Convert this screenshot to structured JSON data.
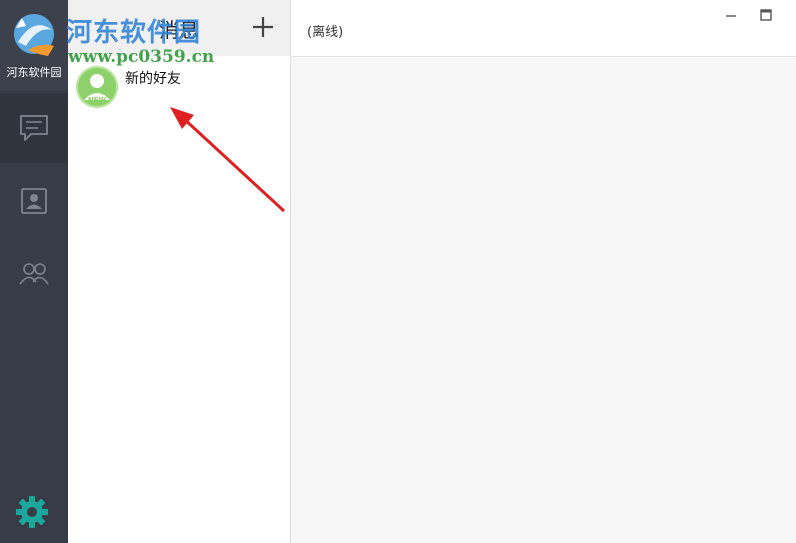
{
  "sidebar": {
    "logo_label": "河东软件园",
    "nav": [
      {
        "icon": "chat-bubble-icon",
        "active": true
      },
      {
        "icon": "contact-card-icon",
        "active": false
      },
      {
        "icon": "group-icon",
        "active": false
      }
    ],
    "settings_icon": "gear-icon",
    "accent_color": "#1aa89a"
  },
  "message_list": {
    "title": "消息",
    "add_icon": "plus-icon",
    "items": [
      {
        "name": "新的好友",
        "avatar_badge": "NEW",
        "avatar_color": "#8ed16a"
      }
    ]
  },
  "chat": {
    "status": "(离线)",
    "window_controls": [
      "minimize-icon",
      "maximize-icon"
    ]
  },
  "watermark": {
    "text": "河东软件园",
    "url": "www.pc0359.cn"
  }
}
